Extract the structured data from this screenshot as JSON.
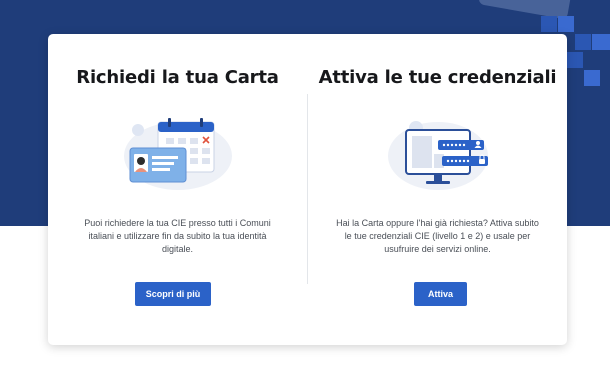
{
  "left_panel": {
    "title": "Richiedi la tua Carta",
    "description": "Puoi richiedere la tua CIE presso tutti i Comuni italiani e utilizzare fin da subito la tua identità digitale.",
    "button_label": "Scopri di più",
    "illustration_icon": "id-card-calendar-icon"
  },
  "right_panel": {
    "title": "Attiva le tue credenziali",
    "description": "Hai la Carta oppure l'hai già richiesta? Attiva subito le tue credenziali CIE (livello 1 e 2) e usale per usufruire dei servizi online.",
    "button_label": "Attiva",
    "illustration_icon": "monitor-credentials-icon"
  },
  "colors": {
    "hero_background": "#1f3d7a",
    "primary_button": "#2b62c8",
    "title_text": "#17181b",
    "body_text": "#4a4f57"
  }
}
